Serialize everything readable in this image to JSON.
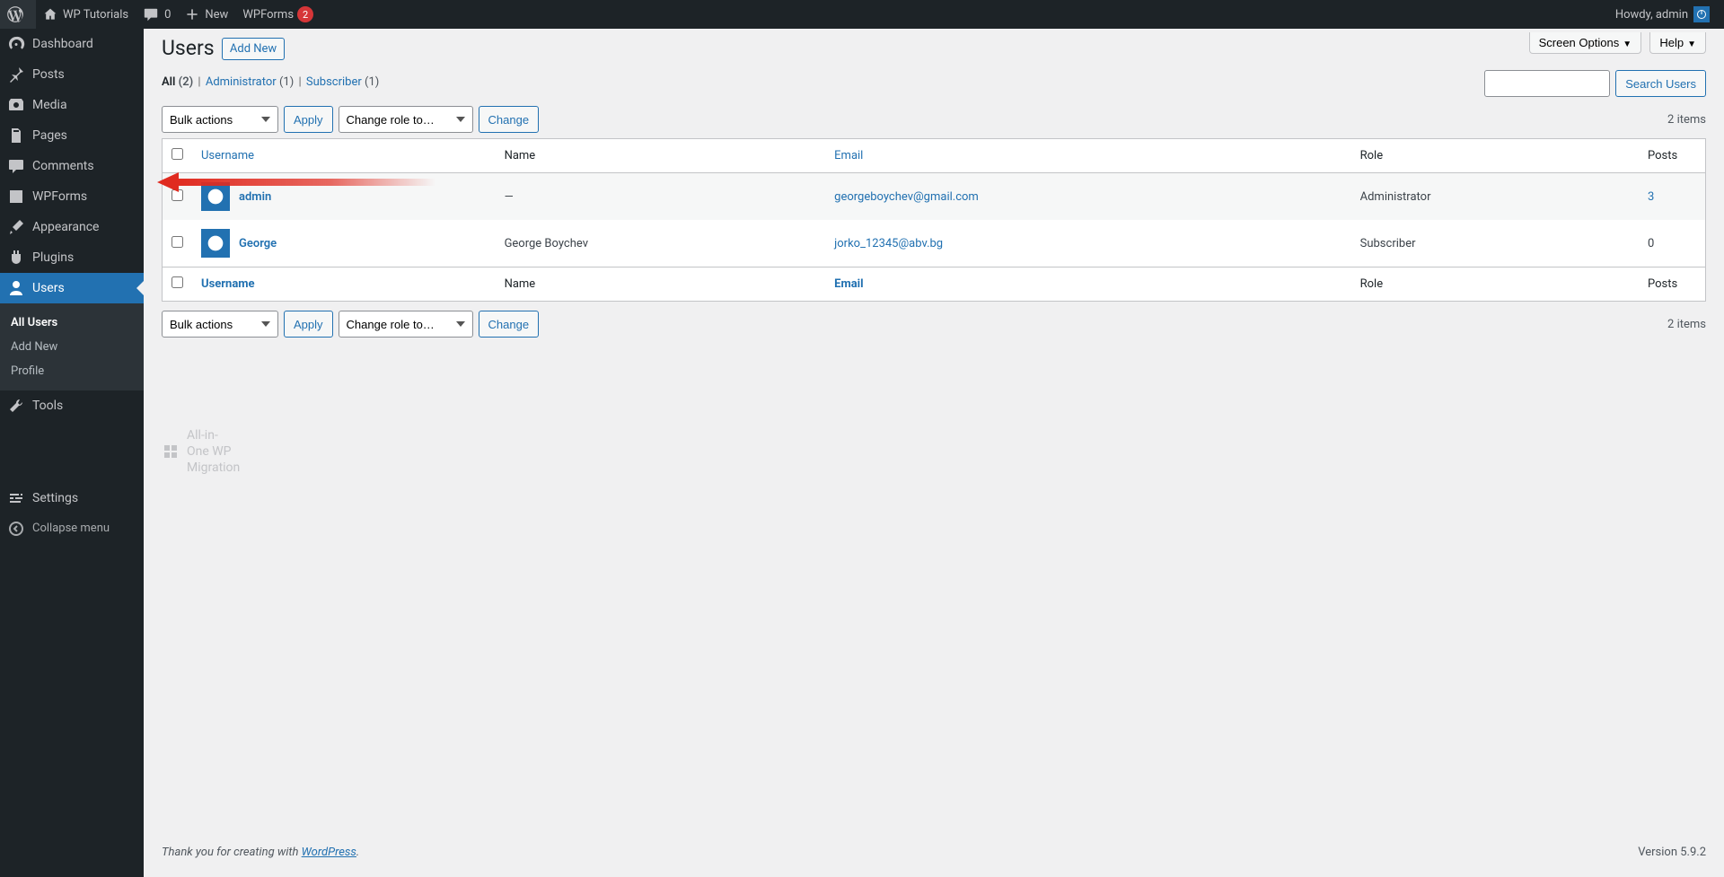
{
  "adminbar": {
    "site_title": "WP Tutorials",
    "comments_count": "0",
    "new_label": "New",
    "wpforms_label": "WPForms",
    "wpforms_badge": "2",
    "howdy": "Howdy, admin"
  },
  "sidebar": {
    "items": [
      {
        "key": "dashboard",
        "label": "Dashboard"
      },
      {
        "key": "posts",
        "label": "Posts"
      },
      {
        "key": "media",
        "label": "Media"
      },
      {
        "key": "pages",
        "label": "Pages"
      },
      {
        "key": "comments",
        "label": "Comments"
      },
      {
        "key": "wpforms",
        "label": "WPForms"
      },
      {
        "key": "appearance",
        "label": "Appearance"
      },
      {
        "key": "plugins",
        "label": "Plugins"
      },
      {
        "key": "users",
        "label": "Users"
      },
      {
        "key": "tools",
        "label": "Tools"
      },
      {
        "key": "aiowpm",
        "label": "All-in-One WP Migration"
      },
      {
        "key": "settings",
        "label": "Settings"
      }
    ],
    "users_submenu": [
      {
        "label": "All Users",
        "current": true
      },
      {
        "label": "Add New"
      },
      {
        "label": "Profile"
      }
    ],
    "collapse_label": "Collapse menu"
  },
  "page": {
    "title": "Users",
    "add_new": "Add New",
    "screen_options": "Screen Options",
    "help": "Help"
  },
  "filters": {
    "all_label": "All",
    "all_count": "(2)",
    "admin_label": "Administrator",
    "admin_count": "(1)",
    "sub_label": "Subscriber",
    "sub_count": "(1)"
  },
  "controls": {
    "bulk_actions": "Bulk actions",
    "apply": "Apply",
    "change_role": "Change role to…",
    "change": "Change",
    "search_users": "Search Users",
    "items_count": "2 items"
  },
  "table": {
    "cols": {
      "username": "Username",
      "name": "Name",
      "email": "Email",
      "role": "Role",
      "posts": "Posts"
    },
    "rows": [
      {
        "username": "admin",
        "name": "—",
        "email": "georgeboychev@gmail.com",
        "role": "Administrator",
        "posts": "3",
        "posts_link": true
      },
      {
        "username": "George",
        "name": "George Boychev",
        "email": "jorko_12345@abv.bg",
        "role": "Subscriber",
        "posts": "0",
        "posts_link": false
      }
    ]
  },
  "footer": {
    "thanks_prefix": "Thank you for creating with ",
    "wp": "WordPress",
    "period": ".",
    "version": "Version 5.9.2"
  }
}
